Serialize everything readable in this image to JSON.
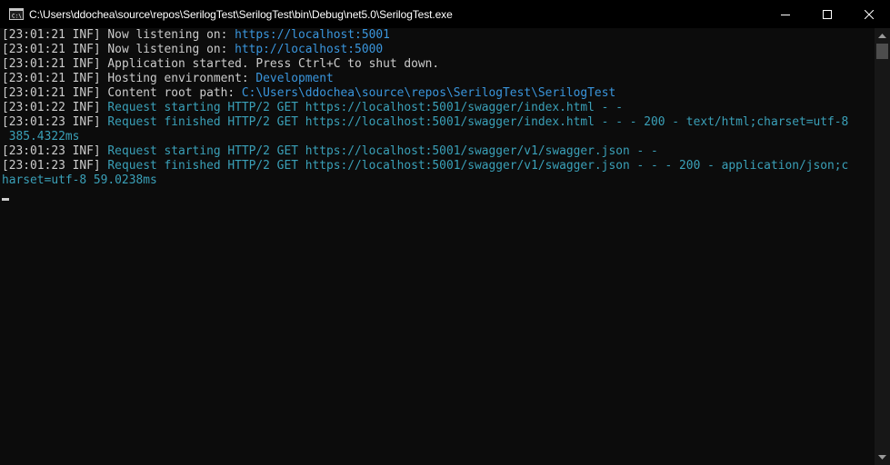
{
  "window": {
    "title": "C:\\Users\\ddochea\\source\\repos\\SerilogTest\\SerilogTest\\bin\\Debug\\net5.0\\SerilogTest.exe",
    "icon": "console-app-icon",
    "controls": {
      "minimize": "minimize-icon",
      "maximize": "maximize-icon",
      "close": "close-icon"
    }
  },
  "colors": {
    "background": "#0c0c0c",
    "text": "#cccccc",
    "highlight": "#3a96dd",
    "info": "#3aa0b8"
  },
  "console": {
    "lines": [
      {
        "prefix": "[23:01:21 INF] ",
        "text": "Now listening on: ",
        "value": "https://localhost:5001"
      },
      {
        "prefix": "[23:01:21 INF] ",
        "text": "Now listening on: ",
        "value": "http://localhost:5000"
      },
      {
        "prefix": "[23:01:21 INF] ",
        "text": "Application started. Press Ctrl+C to shut down.",
        "value": ""
      },
      {
        "prefix": "[23:01:21 INF] ",
        "text": "Hosting environment: ",
        "value": "Development"
      },
      {
        "prefix": "[23:01:21 INF] ",
        "text": "Content root path: ",
        "value": "C:\\Users\\ddochea\\source\\repos\\SerilogTest\\SerilogTest"
      },
      {
        "prefix": "[23:01:22 INF] ",
        "text": "",
        "value": "Request starting HTTP/2 GET https://localhost:5001/swagger/index.html - -"
      },
      {
        "prefix": "[23:01:23 INF] ",
        "text": "",
        "value": "Request finished HTTP/2 GET https://localhost:5001/swagger/index.html - - - 200 - text/html;charset=utf-8"
      },
      {
        "prefix": "",
        "text": "",
        "value": " 385.4322ms"
      },
      {
        "prefix": "[23:01:23 INF] ",
        "text": "",
        "value": "Request starting HTTP/2 GET https://localhost:5001/swagger/v1/swagger.json - -"
      },
      {
        "prefix": "[23:01:23 INF] ",
        "text": "",
        "value": "Request finished HTTP/2 GET https://localhost:5001/swagger/v1/swagger.json - - - 200 - application/json;c"
      },
      {
        "prefix": "",
        "text": "",
        "value": "harset=utf-8 59.0238ms"
      }
    ]
  },
  "scrollbar": {
    "up": "scroll-up-arrow-icon",
    "down": "scroll-down-arrow-icon"
  }
}
